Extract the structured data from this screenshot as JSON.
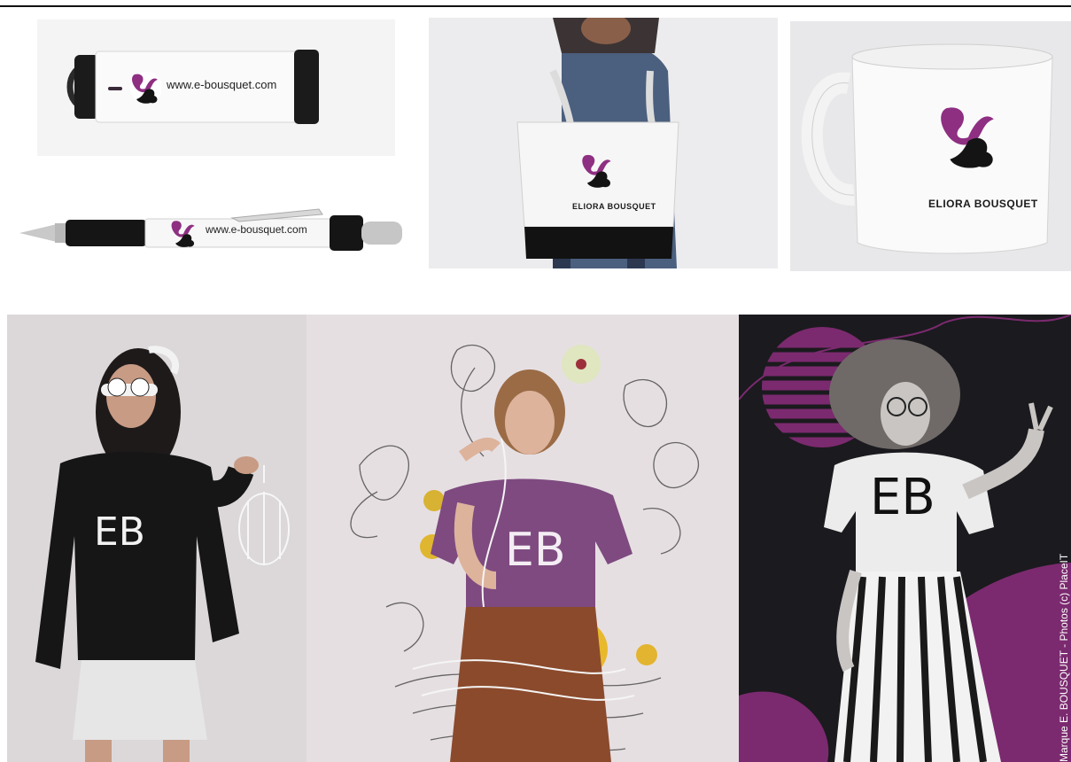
{
  "usb": {
    "url": "www.e-bousquet.com"
  },
  "pen": {
    "url": "www.e-bousquet.com"
  },
  "tote": {
    "brand": "ELIORA BOUSQUET"
  },
  "mug": {
    "brand": "ELIORA BOUSQUET"
  },
  "monogram": "EB",
  "credit": "Marque E. BOUSQUET - Photos (c) PlaceIT",
  "colors": {
    "brand_purple": "#8e2f82",
    "black": "#141414",
    "tee_purple": "#7e4a80"
  },
  "icons": [
    "eb-logo-icon",
    "eb-monogram-icon"
  ]
}
